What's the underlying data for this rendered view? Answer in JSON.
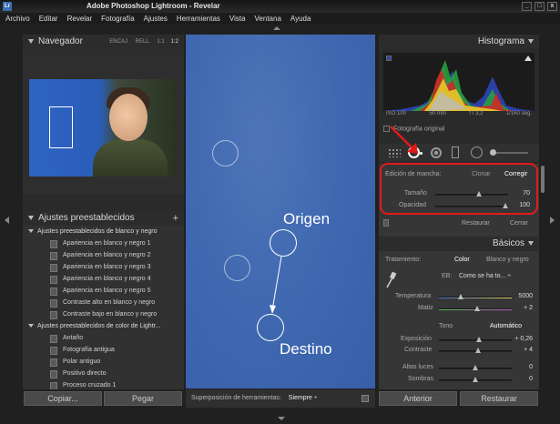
{
  "window": {
    "app_icon": "Lr",
    "title": "Adobe Photoshop Lightroom - Revelar",
    "controls": [
      "_",
      "□",
      "x"
    ]
  },
  "menu": [
    "Archivo",
    "Editar",
    "Revelar",
    "Fotografía",
    "Ajustes",
    "Herramientas",
    "Vista",
    "Ventana",
    "Ayuda"
  ],
  "navigator": {
    "title": "Navegador",
    "zoom_options": [
      "ENCAJ.",
      "RELL.",
      "1:1",
      "1:2"
    ],
    "selected_zoom": "1:2"
  },
  "presets": {
    "title": "Ajustes preestablecidos",
    "add": "+",
    "folders": [
      {
        "name": "Ajustes preestablecidos de blanco y negro",
        "items": [
          "Apariencia en blanco y negro 1",
          "Apariencia en blanco y negro 2",
          "Apariencia en blanco y negro 3",
          "Apariencia en blanco y negro 4",
          "Apariencia en blanco y negro 5",
          "Contraste alto en blanco y negro",
          "Contraste bajo en blanco y negro"
        ]
      },
      {
        "name": "Ajustes preestablecidos de color de Lightr...",
        "items": [
          "Antaño",
          "Fotografía antigua",
          "Polar antiguo",
          "Positivo directo",
          "Proceso cruzado 1"
        ]
      }
    ]
  },
  "left_buttons": {
    "copy": "Copiar...",
    "paste": "Pegar"
  },
  "canvas": {
    "source_label": "Origen",
    "dest_label": "Destino"
  },
  "toolbar": {
    "overlay_label": "Superposición de herramientas:",
    "overlay_value": "Siempre ÷"
  },
  "histogram": {
    "title": "Histograma",
    "exif": [
      "ISO 100",
      "50 mm",
      "f / 3,2",
      "1/160 seg."
    ],
    "original_photo": "Fotografía original"
  },
  "spot_removal": {
    "brush_label": "Edición de mancha:",
    "modes": [
      "Clonar",
      "Corregir"
    ],
    "selected_mode": "Corregir",
    "size_label": "Tamaño",
    "size_value": "70",
    "opacity_label": "Opacidad",
    "opacity_value": "100",
    "reset": "Restaurar",
    "close": "Cerrar"
  },
  "basic": {
    "title": "Básicos",
    "treatment_label": "Tratamiento:",
    "treatment_options": [
      "Color",
      "Blanco y negro"
    ],
    "wb_label": "EB:",
    "wb_value": "Como se ha to... ÷",
    "temp_label": "Temperatura",
    "temp_value": "5000",
    "tint_label": "Matiz",
    "tint_value": "+ 2",
    "tone_label": "Tono",
    "auto": "Automático",
    "exposure_label": "Exposición",
    "exposure_value": "+ 0,26",
    "contrast_label": "Contraste",
    "contrast_value": "+ 4",
    "highlights_label": "Altas luces",
    "highlights_value": "0",
    "shadows_label": "Sombras",
    "shadows_value": "0"
  },
  "right_buttons": {
    "previous": "Anterior",
    "reset": "Restaurar"
  },
  "colors": {
    "highlight_frame": "#e11b1b",
    "photo_bg": "#3f68b0"
  }
}
